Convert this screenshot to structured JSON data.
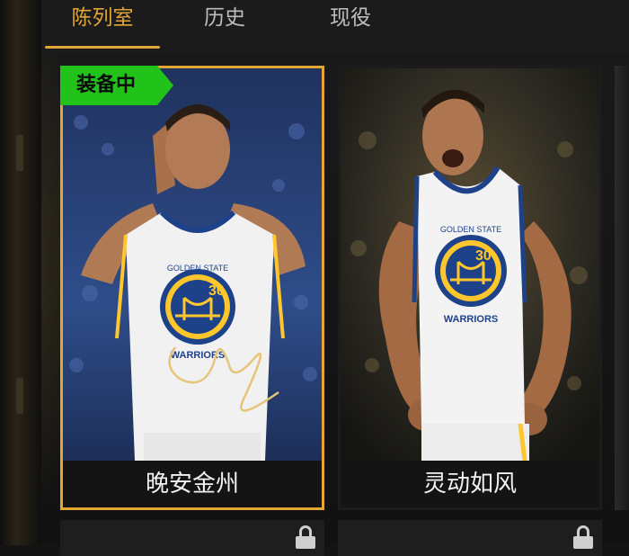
{
  "tabs": [
    {
      "label": "陈列室",
      "active": true
    },
    {
      "label": "历史",
      "active": false
    },
    {
      "label": "现役",
      "active": false
    }
  ],
  "cards": [
    {
      "name": "晚安金州",
      "badge": "装备中",
      "selected": true,
      "jersey_number": "30",
      "team_text_top": "GOLDEN STATE",
      "team_text_bottom": "WARRIORS"
    },
    {
      "name": "灵动如风",
      "badge": "",
      "selected": false,
      "jersey_number": "30",
      "team_text_top": "GOLDEN STATE",
      "team_text_bottom": "WARRIORS"
    }
  ],
  "bottom_row": {
    "locked": true,
    "icon": "lock-icon"
  },
  "colors": {
    "accent": "#e3a633",
    "badge": "#21c21a",
    "jersey_blue": "#1d428a",
    "jersey_gold": "#ffc72c"
  }
}
